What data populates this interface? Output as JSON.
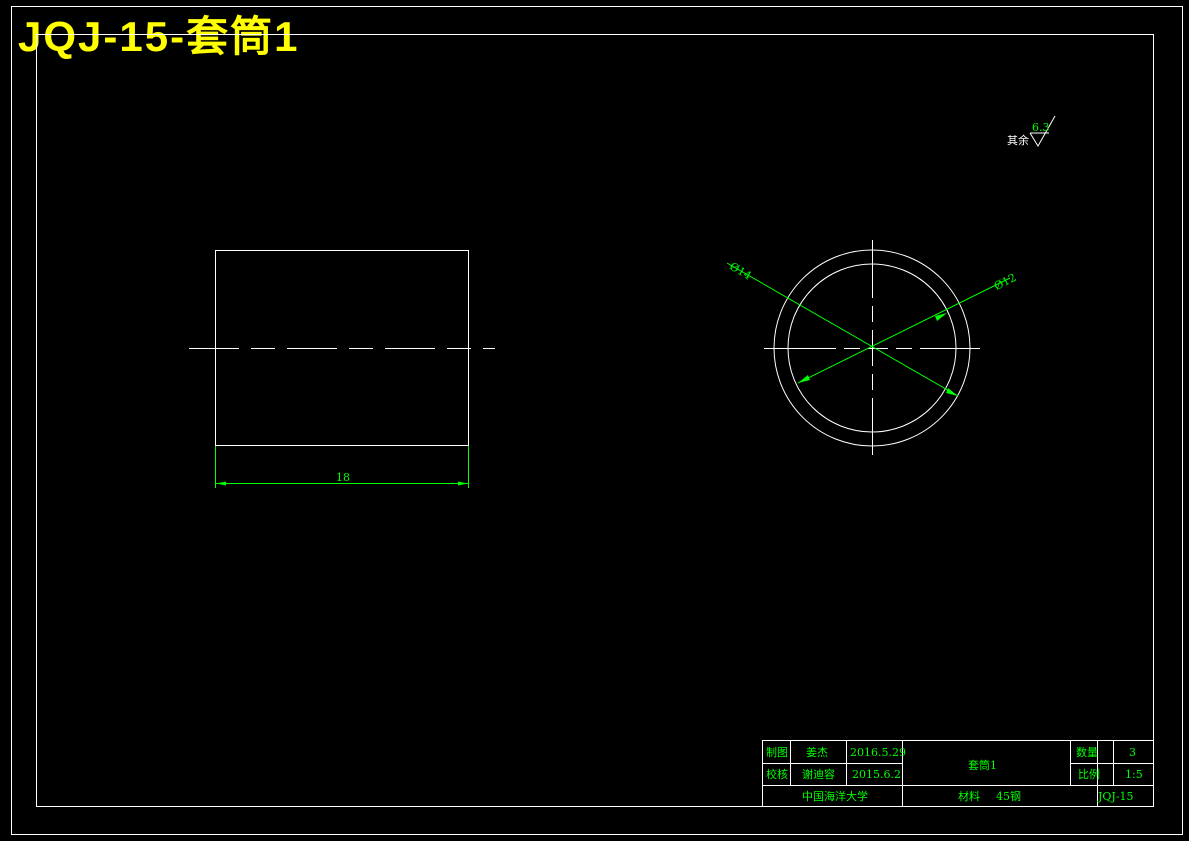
{
  "header": {
    "title": "JQJ-15-套筒1"
  },
  "drawing": {
    "length_dim": "18",
    "outer_diameter_dim": "Ø14",
    "inner_diameter_dim": "Ø12",
    "surface_finish": {
      "prefix": "其余",
      "value": "6.3"
    }
  },
  "title_block": {
    "drawn_label": "制图",
    "drawn_name": "姜杰",
    "drawn_date": "2016.5.29",
    "checked_label": "校核",
    "checked_name": "谢迪容",
    "checked_date": "2015.6.2",
    "part_name": "套筒1",
    "quantity_label": "数量",
    "quantity_value": "3",
    "scale_label": "比例",
    "scale_value": "1:5",
    "school": "中国海洋大学",
    "material_label": "材料",
    "material_value": "45钢",
    "drawing_no": "JQJ-15"
  }
}
